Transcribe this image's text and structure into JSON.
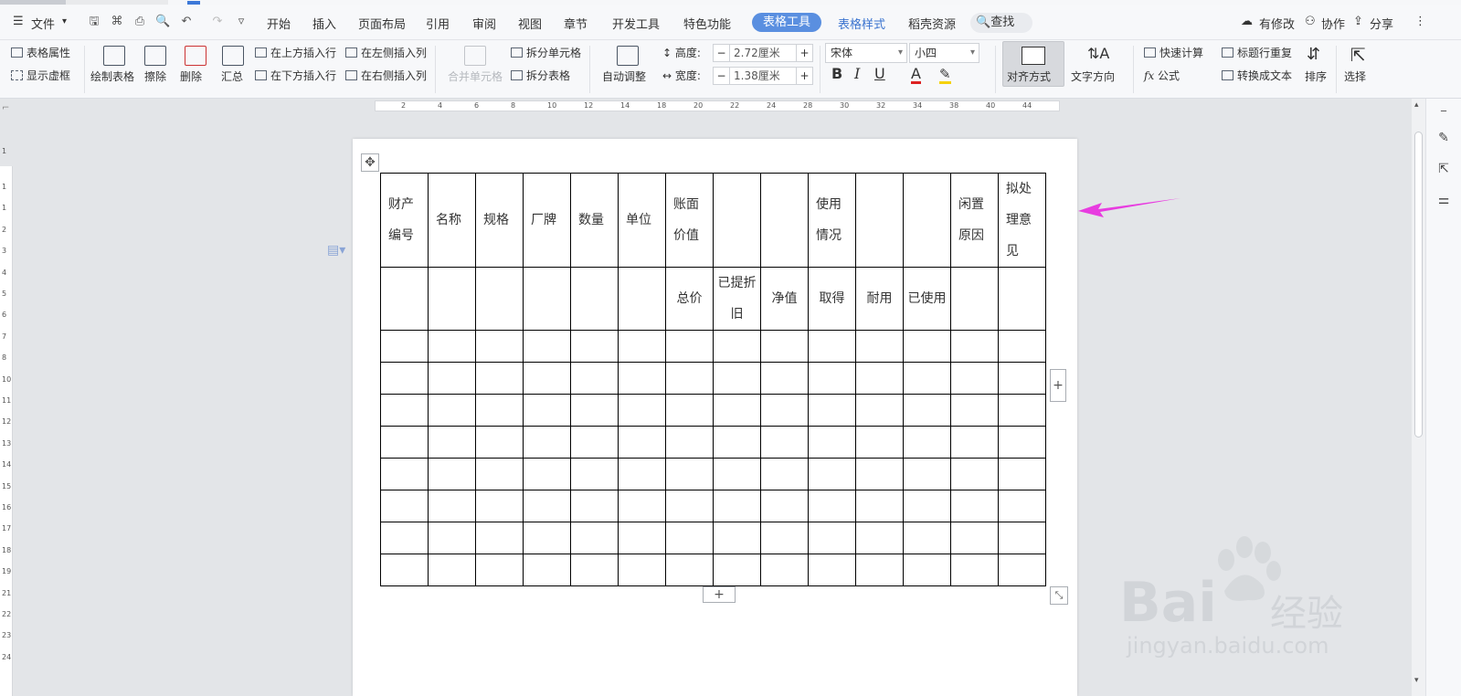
{
  "menu": {
    "file": "文件",
    "tabs": [
      "开始",
      "插入",
      "页面布局",
      "引用",
      "审阅",
      "视图",
      "章节",
      "开发工具",
      "特色功能"
    ],
    "active_tab": "表格工具",
    "table_style_tab": "表格样式",
    "resources_tab": "稻壳资源",
    "search": "查找",
    "changes": "有修改",
    "collaborate": "协作",
    "share": "分享"
  },
  "ribbon": {
    "table_props": "表格属性",
    "show_gridlines": "显示虚框",
    "draw_table": "绘制表格",
    "erase": "擦除",
    "delete": "删除",
    "summary": "汇总",
    "insert_row_above": "在上方插入行",
    "insert_row_below": "在下方插入行",
    "insert_col_left": "在左侧插入列",
    "insert_col_right": "在右侧插入列",
    "merge_cells": "合并单元格",
    "split_cells": "拆分单元格",
    "split_table": "拆分表格",
    "auto_fit": "自动调整",
    "height_label": "高度:",
    "height_value": "2.72厘米",
    "width_label": "宽度:",
    "width_value": "1.38厘米",
    "font_name": "宋体",
    "font_size": "小四",
    "align": "对齐方式",
    "text_direction": "文字方向",
    "quick_calc": "快速计算",
    "formula": "公式",
    "title_repeat": "标题行重复",
    "to_text": "转换成文本",
    "sort": "排序",
    "select": "选择"
  },
  "ruler": {
    "h_ticks": [
      "2",
      "4",
      "6",
      "8",
      "10",
      "12",
      "14",
      "18",
      "20",
      "22",
      "24",
      "28",
      "30",
      "32",
      "34",
      "38",
      "40",
      "44"
    ],
    "v_ticks": [
      "1",
      "1",
      "2",
      "3",
      "4",
      "5",
      "6",
      "7",
      "8",
      "10",
      "11",
      "12",
      "13",
      "14",
      "15",
      "16",
      "17",
      "18",
      "19",
      "21",
      "22",
      "23",
      "24"
    ]
  },
  "table": {
    "header1": [
      "财产编号",
      "名称",
      "规格",
      "厂牌",
      "数量",
      "单位",
      "账面价值",
      "",
      "",
      "使用情况",
      "",
      "",
      "闲置原因",
      "拟处理意见"
    ],
    "header2": [
      "",
      "",
      "",
      "",
      "",
      "",
      "总价",
      "已提折旧",
      "净值",
      "取得",
      "耐用",
      "已使用",
      "",
      ""
    ],
    "empty_rows": 8
  },
  "watermark": {
    "brand": "Bai",
    "brand2": "经验",
    "url": "jingyan.baidu.com"
  },
  "colors": {
    "accent": "#5a8fe0",
    "arrow": "#e83ce0"
  }
}
